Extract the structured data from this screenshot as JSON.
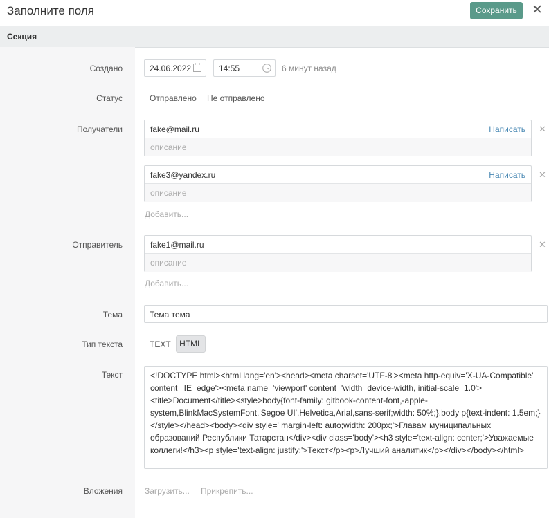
{
  "header": {
    "title": "Заполните поля",
    "save_label": "Сохранить",
    "close_label": "✕"
  },
  "section": {
    "title": "Секция"
  },
  "created": {
    "label": "Создано",
    "date": "24.06.2022",
    "time": "14:55",
    "relative": "6 минут назад",
    "date_icon": "calendar-icon",
    "time_icon": "clock-icon"
  },
  "status": {
    "label": "Статус",
    "options": [
      "Отправлено",
      "Не отправлено"
    ]
  },
  "recipients": {
    "label": "Получатели",
    "items": [
      {
        "email": "fake@mail.ru",
        "write": "Написать",
        "desc_placeholder": "описание"
      },
      {
        "email": "fake3@yandex.ru",
        "write": "Написать",
        "desc_placeholder": "описание"
      }
    ],
    "add_label": "Добавить..."
  },
  "sender": {
    "label": "Отправитель",
    "email": "fake1@mail.ru",
    "desc_placeholder": "описание",
    "add_label": "Добавить..."
  },
  "topic": {
    "label": "Тема",
    "value": "Тема тема"
  },
  "text_type": {
    "label": "Тип текста",
    "options": [
      "TEXT",
      "HTML"
    ],
    "selected": "HTML"
  },
  "text": {
    "label": "Текст",
    "value": "<!DOCTYPE html><html lang='en'><head><meta charset='UTF-8'><meta http-equiv='X-UA-Compatible' content='IE=edge'><meta name='viewport' content='width=device-width, initial-scale=1.0'><title>Document</title><style>body{font-family: gitbook-content-font,-apple-system,BlinkMacSystemFont,'Segoe UI',Helvetica,Arial,sans-serif;width: 50%;}.body p{text-indent: 1.5em;}</style></head><body><div style=' margin-left: auto;width: 200px;'>Главам муниципальных образований Республики Татарстан</div><div class='body'><h3 style='text-align: center;'>Уважаемые коллеги!</h3><p style='text-align: justify;'>Текст</p><p>Лучший аналитик</p></div></body></html>"
  },
  "attachments": {
    "label": "Вложения",
    "upload": "Загрузить...",
    "attach": "Прикрепить..."
  },
  "colors": {
    "accent": "#5a9a8a",
    "link": "#4a89b4",
    "section_bg": "#eceeef",
    "label_panel_bg": "#f6f6f7"
  }
}
